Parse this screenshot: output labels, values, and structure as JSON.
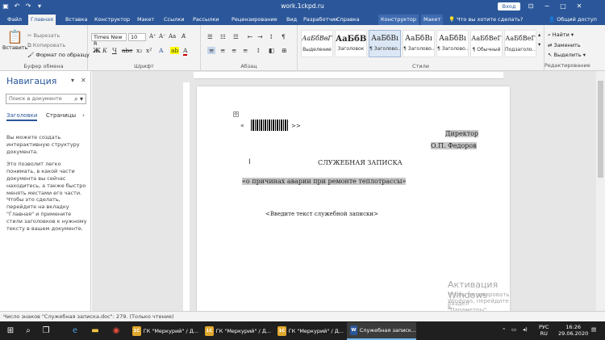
{
  "titlebar": {
    "title": "work.1ckpd.ru",
    "sign_in": "Вход",
    "bg": "#2b579a"
  },
  "tabs": [
    {
      "label": "Файл"
    },
    {
      "label": "Главная"
    },
    {
      "label": "Вставка"
    },
    {
      "label": "Конструктор"
    },
    {
      "label": "Макет"
    },
    {
      "label": "Ссылки"
    },
    {
      "label": "Рассылки"
    },
    {
      "label": "Рецензирование"
    },
    {
      "label": "Вид"
    },
    {
      "label": "Разработчик"
    },
    {
      "label": "Справка"
    },
    {
      "label": "Конструктор"
    },
    {
      "label": "Макет"
    }
  ],
  "tell_me": "Что вы хотите сделать?",
  "share": "Общий доступ",
  "ribbon": {
    "clipboard": {
      "paste": "Вставить",
      "cut": "Вырезать",
      "copy": "Копировать",
      "format_painter": "Формат по образцу",
      "group": "Буфер обмена"
    },
    "font": {
      "name": "Times New R",
      "size": "10",
      "group": "Шрифт"
    },
    "paragraph": {
      "group": "Абзац"
    },
    "styles": {
      "group": "Стили",
      "items": [
        {
          "sample": "АаБбВвГ",
          "name": "Выделение"
        },
        {
          "sample": "АаБбВ",
          "name": "Заголовок"
        },
        {
          "sample": "АаБбВı",
          "name": "¶ Заголово..."
        },
        {
          "sample": "АаБбВı",
          "name": "¶ Заголово..."
        },
        {
          "sample": "АаБбВı",
          "name": "¶ Заголово..."
        },
        {
          "sample": "АаБбВеГ",
          "name": "¶ Обычный"
        },
        {
          "sample": "АаБбВеГ",
          "name": "Подзаголо..."
        }
      ]
    },
    "editing": {
      "find": "Найти",
      "replace": "Заменить",
      "select": "Выделить",
      "group": "Редактирование"
    }
  },
  "navigation": {
    "title": "Навигация",
    "search_placeholder": "Поиск в документе",
    "tab_headings": "Заголовки",
    "tab_pages": "Страницы",
    "text1": "Вы можете создать интерактивную структуру документа.",
    "text2": "Это позволит легко понимать, в какой части документа вы сейчас находитесь, а также быстро менять местами его части.",
    "text3": "Чтобы это сделать, перейдите на вкладку \"Главная\" и примените стили заголовков к нужному тексту в вашем документе."
  },
  "document": {
    "open_quote": "«",
    "close_quote": ">>",
    "director": "Директор",
    "director_name": "О.П. Федоров",
    "heading": "СЛУЖЕБНАЯ ЗАПИСКА",
    "subject": "«о причинах аварии при ремонте теплотрассы»",
    "placeholder": "<Введите текст служебной записки>"
  },
  "watermark": {
    "line1": "Активация Windows",
    "line2": "Чтобы активировать Windows, перейдите в",
    "line3": "раздел \"Параметры\"."
  },
  "status": "Число знаков \"Служебная записка.doc\": 279. (Только чтение)",
  "taskbar": {
    "apps": [
      {
        "label": "ГК \"Меркурий\" / Д...",
        "icon": "1C"
      },
      {
        "label": "ГК \"Меркурий\" / Д...",
        "icon": "1C"
      },
      {
        "label": "ГК \"Меркурий\" / Д...",
        "icon": "1C"
      },
      {
        "label": "Служебная записк...",
        "icon": "W"
      }
    ],
    "lang": "РУС",
    "lang2": "RU",
    "time": "16:26",
    "date": "29.06.2020"
  }
}
